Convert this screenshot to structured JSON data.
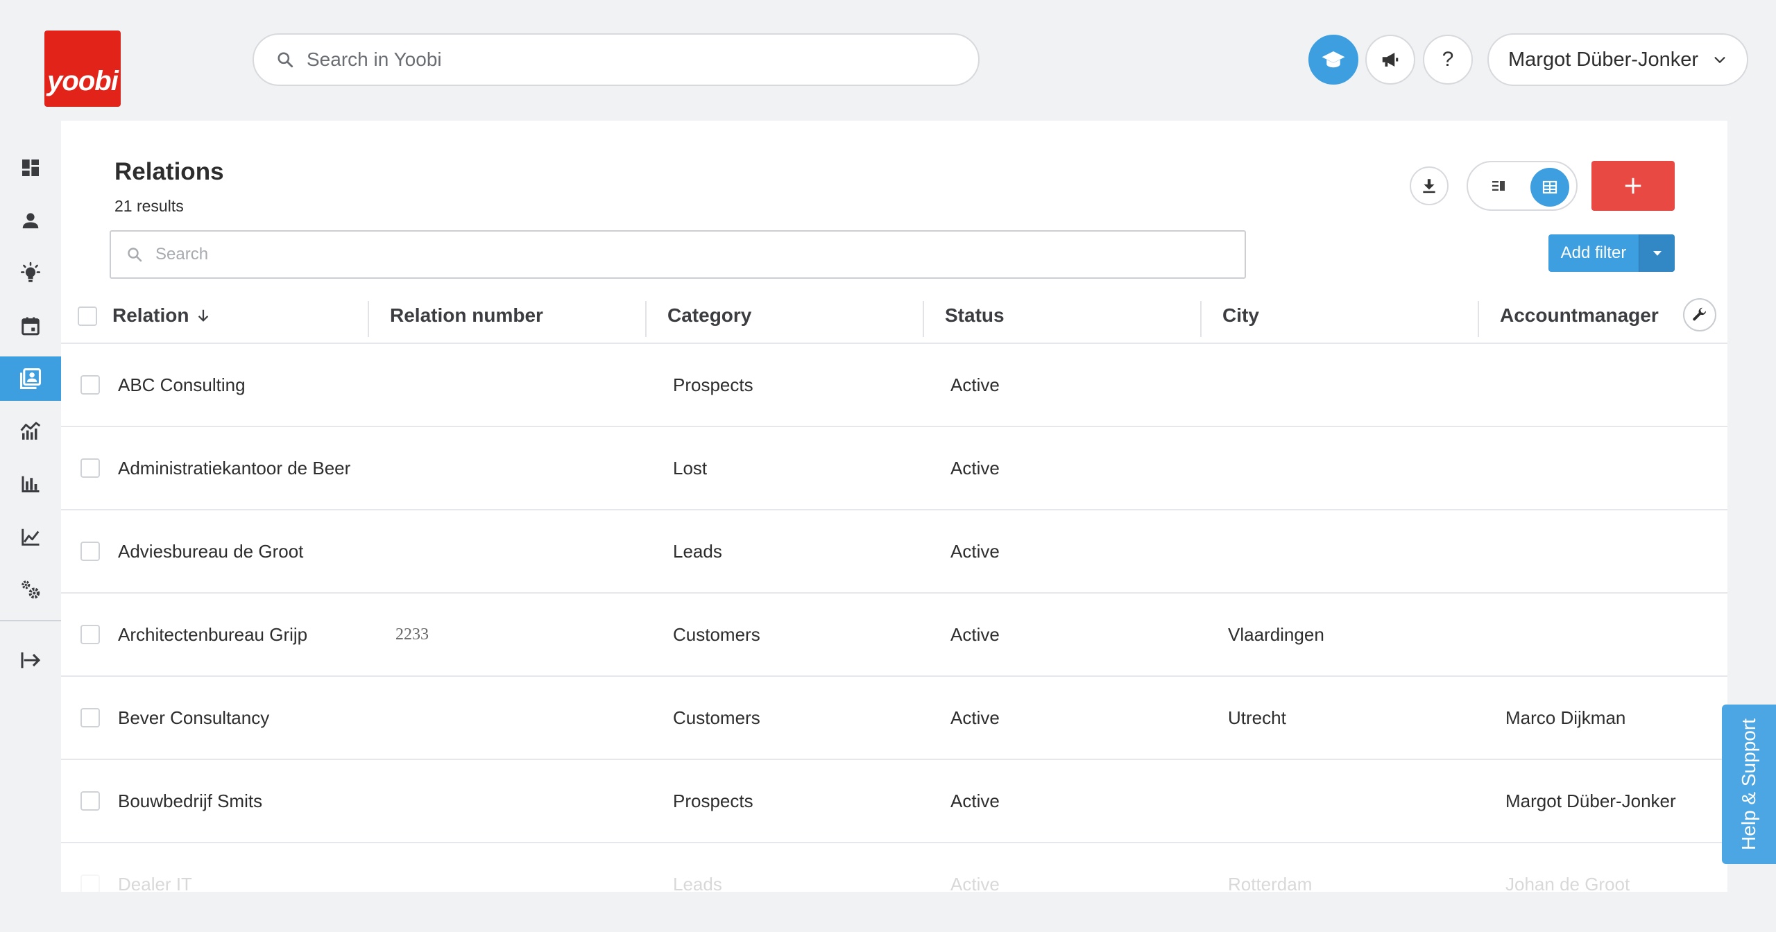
{
  "brand": {
    "logo_text": "yoobi",
    "color": "#e2231a",
    "accent": "#3d9ee0"
  },
  "header": {
    "search_placeholder": "Search in Yoobi",
    "help_label": "?",
    "user_name": "Margot Düber-Jonker",
    "icons": [
      "academy-icon",
      "megaphone-icon",
      "help-icon",
      "chevron-down-icon"
    ]
  },
  "sidebar": {
    "items": [
      {
        "name": "dashboard",
        "icon": "dashboard-icon",
        "active": false
      },
      {
        "name": "people",
        "icon": "person-icon",
        "active": false
      },
      {
        "name": "ideas",
        "icon": "lightbulb-icon",
        "active": false
      },
      {
        "name": "calendar",
        "icon": "calendar-icon",
        "active": false
      },
      {
        "name": "relations",
        "icon": "contacts-icon",
        "active": true
      },
      {
        "name": "sales",
        "icon": "trend-chart-icon",
        "active": false
      },
      {
        "name": "reports",
        "icon": "bar-chart-icon",
        "active": false
      },
      {
        "name": "analytics",
        "icon": "line-chart-icon",
        "active": false
      },
      {
        "name": "settings",
        "icon": "gears-icon",
        "active": false
      }
    ],
    "collapse_icon": "expand-arrow-icon"
  },
  "page": {
    "title": "Relations",
    "results": "21 results",
    "search_placeholder": "Search",
    "add_filter_label": "Add filter",
    "add_button": "+",
    "add_button_color": "#e84a43"
  },
  "table": {
    "columns": [
      "Relation",
      "Relation number",
      "Category",
      "Status",
      "City",
      "Accountmanager"
    ],
    "sort_column": "Relation",
    "sort_direction": "descending-arrow",
    "rows": [
      {
        "relation": "ABC Consulting",
        "number": "",
        "category": "Prospects",
        "status": "Active",
        "city": "",
        "manager": ""
      },
      {
        "relation": "Administratiekantoor de Beer",
        "number": "",
        "category": "Lost",
        "status": "Active",
        "city": "",
        "manager": ""
      },
      {
        "relation": "Adviesbureau de Groot",
        "number": "",
        "category": "Leads",
        "status": "Active",
        "city": "",
        "manager": ""
      },
      {
        "relation": "Architectenbureau Grijp",
        "number": "2233",
        "category": "Customers",
        "status": "Active",
        "city": "Vlaardingen",
        "manager": ""
      },
      {
        "relation": "Bever Consultancy",
        "number": "",
        "category": "Customers",
        "status": "Active",
        "city": "Utrecht",
        "manager": "Marco Dijkman"
      },
      {
        "relation": "Bouwbedrijf Smits",
        "number": "",
        "category": "Prospects",
        "status": "Active",
        "city": "",
        "manager": "Margot Düber-Jonker"
      },
      {
        "relation": "Dealer IT",
        "number": "",
        "category": "Leads",
        "status": "Active",
        "city": "Rotterdam",
        "manager": "Johan de Groot"
      }
    ]
  },
  "help_tab": {
    "label": "Help & Support"
  }
}
